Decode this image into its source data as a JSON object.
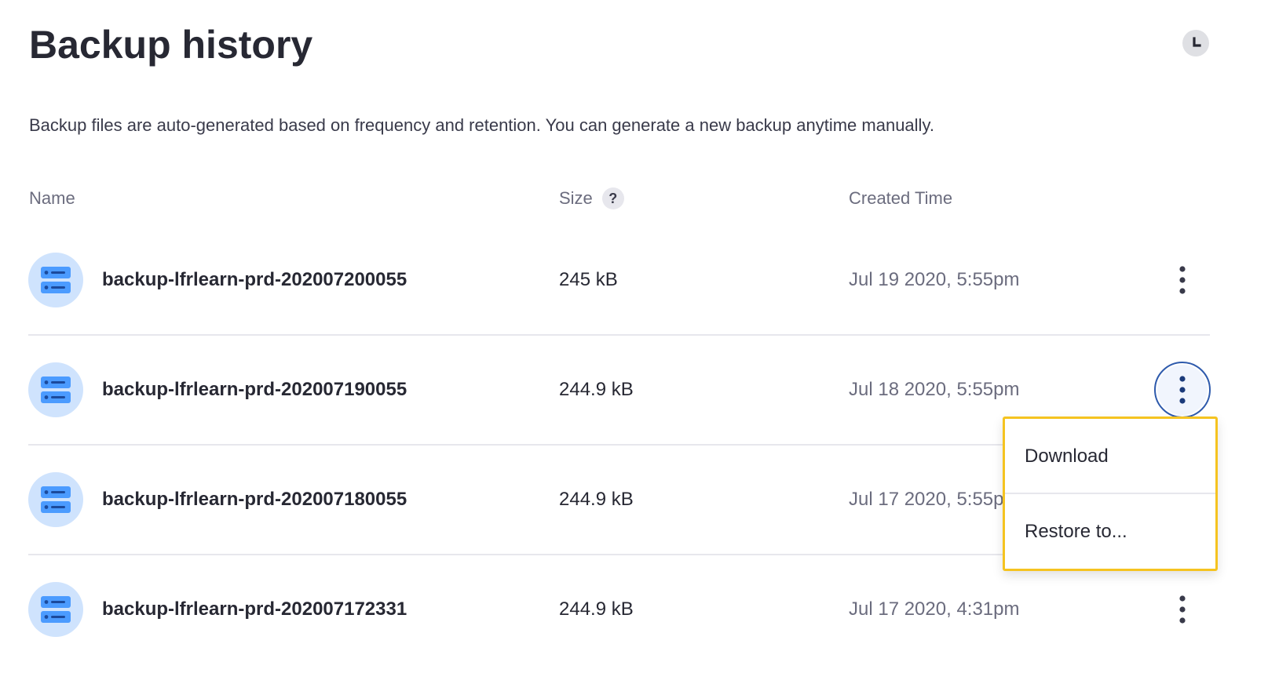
{
  "page": {
    "title": "Backup history",
    "description": "Backup files are auto-generated based on frequency and retention. You can generate a new backup anytime manually."
  },
  "icons": {
    "clock": "clock-icon",
    "help": "question-icon",
    "file": "backup-file-icon",
    "kebab": "kebab-menu-icon"
  },
  "table": {
    "headers": {
      "name": "Name",
      "size": "Size",
      "size_help": "?",
      "created": "Created Time"
    },
    "rows": [
      {
        "name": "backup-lfrlearn-prd-202007200055",
        "size": "245 kB",
        "created": "Jul 19 2020, 5:55pm"
      },
      {
        "name": "backup-lfrlearn-prd-202007190055",
        "size": "244.9 kB",
        "created": "Jul 18 2020, 5:55pm"
      },
      {
        "name": "backup-lfrlearn-prd-202007180055",
        "size": "244.9 kB",
        "created": "Jul 17 2020, 5:55p"
      },
      {
        "name": "backup-lfrlearn-prd-202007172331",
        "size": "244.9 kB",
        "created": "Jul 17 2020, 4:31pm"
      }
    ]
  },
  "dropdown": {
    "items": [
      {
        "label": "Download"
      },
      {
        "label": "Restore to..."
      }
    ],
    "highlight_color": "#f5c320"
  },
  "colors": {
    "accent": "#2e5aac",
    "icon_bg": "#cfe3fd",
    "icon_fg": "#4b9bff"
  }
}
